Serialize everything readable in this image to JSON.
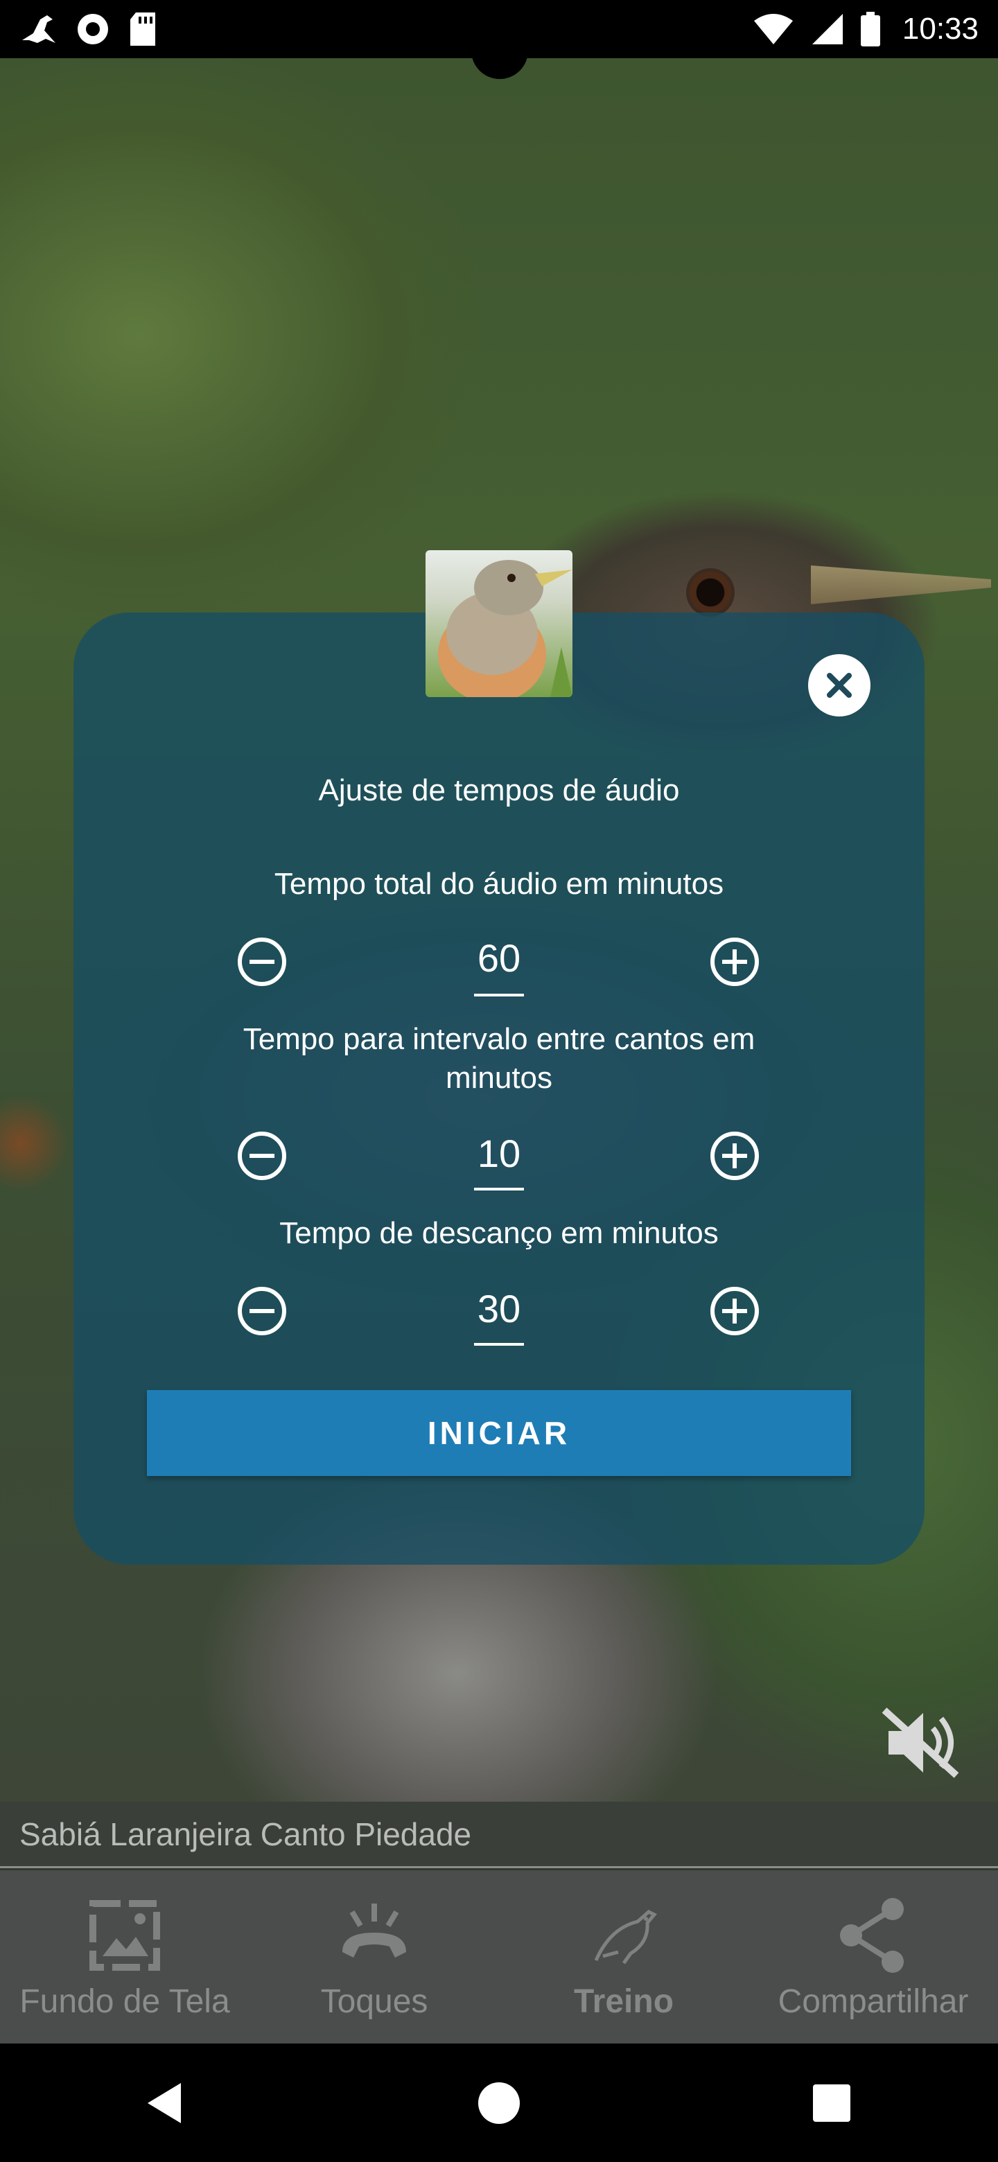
{
  "status_bar": {
    "time": "10:33",
    "icons": [
      "bird-notification-icon",
      "record-icon",
      "sd-card-icon",
      "wifi-icon",
      "signal-icon",
      "battery-icon"
    ]
  },
  "dialog": {
    "title": "Ajuste de tempos de áudio",
    "total_label": "Tempo total do áudio em minutos",
    "total_value": "60",
    "interval_label": "Tempo para intervalo entre cantos em minutos",
    "interval_value": "10",
    "rest_label": "Tempo de descanço em minutos",
    "rest_value": "30",
    "start_label": "INICIAR"
  },
  "track": {
    "title": "Sabiá Laranjeira Canto Piedade"
  },
  "bottom_nav": {
    "items": [
      {
        "label": "Fundo de Tela",
        "icon": "wallpaper-icon"
      },
      {
        "label": "Toques",
        "icon": "ringtone-icon"
      },
      {
        "label": "Treino",
        "icon": "bird-training-icon",
        "active": true
      },
      {
        "label": "Compartilhar",
        "icon": "share-icon"
      }
    ]
  },
  "colors": {
    "dialog_bg": "#164e64",
    "button": "#1f7db5"
  }
}
